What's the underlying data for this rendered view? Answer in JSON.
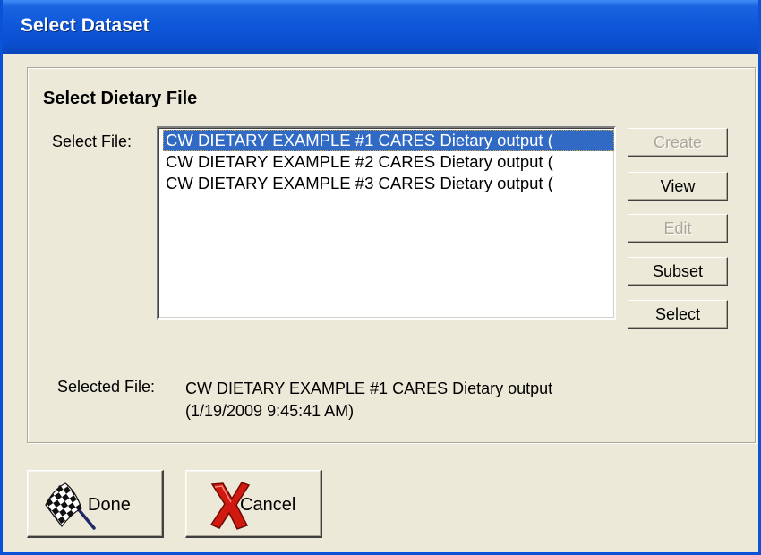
{
  "window": {
    "title": "Select Dataset"
  },
  "group": {
    "title": "Select Dietary File"
  },
  "file_select": {
    "label": "Select File:",
    "items": [
      "CW DIETARY EXAMPLE #1 CARES Dietary output (",
      "CW DIETARY EXAMPLE #2 CARES Dietary output (",
      "CW DIETARY EXAMPLE #3 CARES Dietary output ("
    ],
    "selected_index": 0
  },
  "side_buttons": {
    "create": "Create",
    "view": "View",
    "edit": "Edit",
    "subset": "Subset",
    "select": "Select"
  },
  "selected_file": {
    "label": "Selected File:",
    "value": "CW DIETARY EXAMPLE #1 CARES Dietary output (1/19/2009 9:45:41 AM)"
  },
  "footer": {
    "done_label": "Done",
    "cancel_label": "Cancel"
  },
  "colors": {
    "title_bar": "#0b4fd0",
    "selection": "#316ac5",
    "dialog_bg": "#ece9d8",
    "cancel_x": "#d11a0f"
  },
  "icons": {
    "done": "checkered-flag-icon",
    "cancel": "red-x-icon"
  }
}
